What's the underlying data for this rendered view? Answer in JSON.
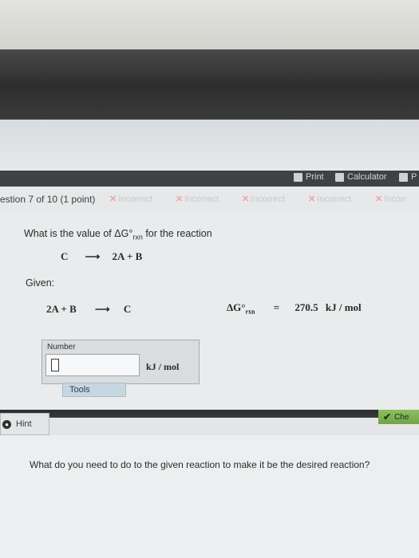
{
  "toolbar": {
    "print_label": "Print",
    "calculator_label": "Calculator",
    "more_label": "P"
  },
  "question": {
    "number_text": "estion 7 of 10 (1 point)",
    "attempts": [
      "Incorrect",
      "Incorrect",
      "Incorrect",
      "Incorrect",
      "Incorr"
    ]
  },
  "prompt": {
    "before": "What is the value of ΔG°",
    "sub": "rxn",
    "after": " for the reaction"
  },
  "target_reaction": {
    "left": "C",
    "arrow": "⟶",
    "right": "2A  +  B"
  },
  "given": {
    "label": "Given:",
    "reaction_left": "2A  +  B",
    "arrow": "⟶",
    "reaction_right": "C",
    "dg_symbol": "ΔG°",
    "dg_sub": "rxn",
    "equals": "=",
    "value": "270.5",
    "unit": "kJ / mol"
  },
  "answer": {
    "label": "Number",
    "value": "",
    "unit": "kJ / mol"
  },
  "tools_label": "Tools",
  "hint_label": "Hint",
  "check_label": "Che",
  "hint_text": "What do you need to do to the given reaction to make it be the desired reaction?"
}
